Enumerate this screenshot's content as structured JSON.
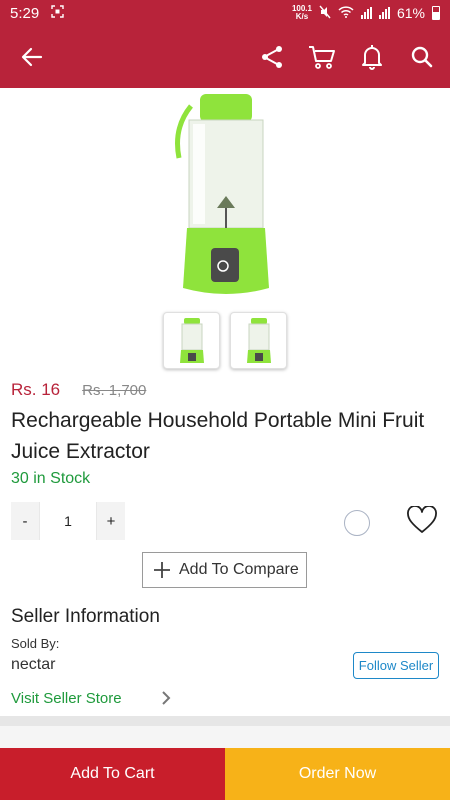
{
  "status_bar": {
    "time": "5:29",
    "net_speed_value": "100.1",
    "net_speed_unit": "K/s",
    "battery": "61%"
  },
  "app_bar": {
    "icons": [
      "back-arrow-icon",
      "share-icon",
      "cart-icon",
      "bell-icon",
      "search-icon"
    ]
  },
  "product": {
    "price": "Rs. 16",
    "old_price": "Rs. 1,700",
    "title": "Rechargeable Household Portable Mini Fruit Juice Extractor",
    "stock": "30 in Stock",
    "quantity": {
      "minus": "-",
      "value": "1",
      "plus": "+"
    },
    "thumbnails": 2
  },
  "compare": {
    "icon": "+",
    "label": "Add To Compare"
  },
  "seller": {
    "heading": "Seller Information",
    "sold_by_label": "Sold By:",
    "name": "nectar",
    "follow_label": "Follow Seller",
    "visit_label": "Visit Seller Store"
  },
  "actions": {
    "add_to_cart": "Add To Cart",
    "order_now": "Order Now"
  },
  "colors": {
    "brand": "#b8233a",
    "cart_button": "#c81e2b",
    "order_button": "#f7b218",
    "stock_green": "#1f9a3c",
    "follow_blue": "#1e88c8"
  }
}
